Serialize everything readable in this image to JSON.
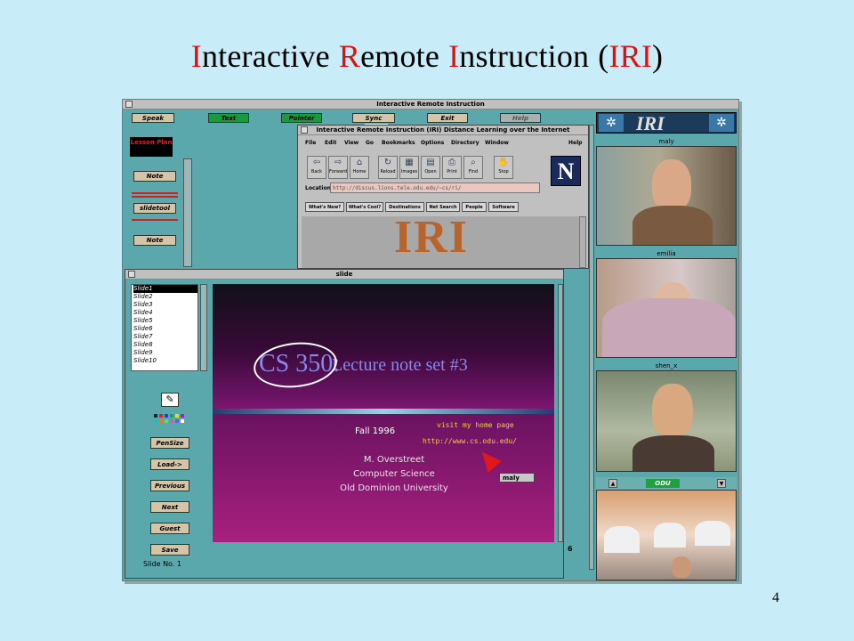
{
  "slide": {
    "title_parts": [
      {
        "initial": "I",
        "rest": "nteractive"
      },
      {
        "initial": "R",
        "rest": "emote"
      },
      {
        "initial": "I",
        "rest": "nstruction"
      }
    ],
    "title_paren_open": "(",
    "title_abbrev": "IRI",
    "title_paren_close": ")",
    "page_number": "4"
  },
  "app": {
    "window_title": "Interactive Remote Instruction",
    "toolbar": [
      "Speak",
      "Text",
      "Pointer",
      "Sync",
      "Exit",
      "Help"
    ],
    "active_user": "maly",
    "lesson_plan": {
      "header": "Lesson Plan",
      "items": [
        "Note",
        "slidetool",
        "Note"
      ]
    },
    "browser": {
      "title": "Interactive Remote Instruction (IRI)   Distance Learning over the Internet",
      "menu": [
        "File",
        "Edit",
        "View",
        "Go",
        "Bookmarks",
        "Options",
        "Directory",
        "Window",
        "Help"
      ],
      "nav_buttons": [
        "Back",
        "Forward",
        "Home",
        "Reload",
        "Images",
        "Open",
        "Print",
        "Find",
        "Stop"
      ],
      "location_label": "Location:",
      "location_value": "http://discus.lions.tele.odu.edu/~cs/ri/",
      "dir_buttons": [
        "What's New?",
        "What's Cool?",
        "Destinations",
        "Net Search",
        "People",
        "Software"
      ],
      "logo_letter": "N",
      "page_logo": "IRI"
    },
    "video_panel": {
      "banner": "IRI",
      "participants": [
        "maly",
        "emilia",
        "shen_x"
      ],
      "room_label": "ODU"
    },
    "slide_window": {
      "title": "slide",
      "slides": [
        "Slide1",
        "Slide2",
        "Slide3",
        "Slide4",
        "Slide5",
        "Slide6",
        "Slide7",
        "Slide8",
        "Slide9",
        "Slide10"
      ],
      "tool_buttons": [
        "PenSize",
        "Load->",
        "Previous",
        "Next",
        "Guest",
        "Save"
      ],
      "status": "Slide No. 1",
      "page_indicator": "6",
      "content": {
        "course": "CS 350:",
        "lecture": "Lecture note set #3",
        "term": "Fall 1996",
        "author_lines": [
          "M. Overstreet",
          "Computer Science",
          "Old Dominion University"
        ],
        "visit_text": "visit my home page",
        "url": "http://www.cs.odu.edu/",
        "pointer_label": "maly"
      }
    }
  }
}
